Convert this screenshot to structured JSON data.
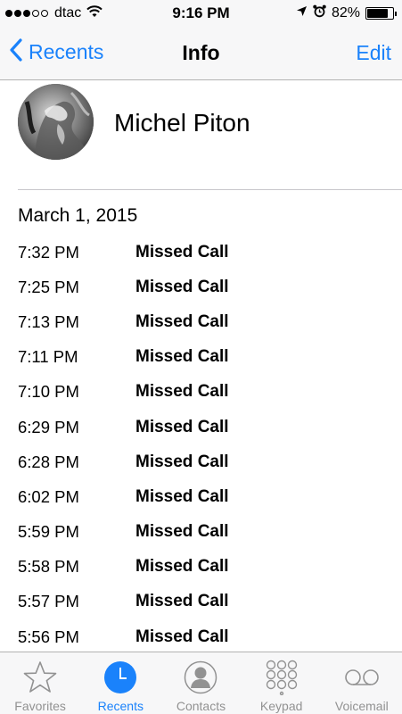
{
  "status_bar": {
    "carrier": "dtac",
    "time": "9:16 PM",
    "battery_pct": "82%",
    "battery_level": 0.82,
    "signal_bars": 3
  },
  "nav": {
    "back_label": "Recents",
    "title": "Info",
    "edit_label": "Edit"
  },
  "contact": {
    "name": "Michel Piton"
  },
  "date": "March 1, 2015",
  "calls": [
    {
      "time": "7:32 PM",
      "type": "Missed Call"
    },
    {
      "time": "7:25 PM",
      "type": "Missed Call"
    },
    {
      "time": "7:13 PM",
      "type": "Missed Call"
    },
    {
      "time": "7:11 PM",
      "type": "Missed Call"
    },
    {
      "time": "7:10 PM",
      "type": "Missed Call"
    },
    {
      "time": "6:29 PM",
      "type": "Missed Call"
    },
    {
      "time": "6:28 PM",
      "type": "Missed Call"
    },
    {
      "time": "6:02 PM",
      "type": "Missed Call"
    },
    {
      "time": "5:59 PM",
      "type": "Missed Call"
    },
    {
      "time": "5:58 PM",
      "type": "Missed Call"
    },
    {
      "time": "5:57 PM",
      "type": "Missed Call"
    },
    {
      "time": "5:56 PM",
      "type": "Missed Call"
    }
  ],
  "tabs": [
    {
      "label": "Favorites",
      "icon": "star-icon",
      "active": false
    },
    {
      "label": "Recents",
      "icon": "clock-icon",
      "active": true
    },
    {
      "label": "Contacts",
      "icon": "person-icon",
      "active": false
    },
    {
      "label": "Keypad",
      "icon": "keypad-icon",
      "active": false
    },
    {
      "label": "Voicemail",
      "icon": "voicemail-icon",
      "active": false
    }
  ],
  "colors": {
    "accent": "#1a82fb",
    "inactive": "#929292",
    "bar_bg": "#f7f7f8"
  }
}
